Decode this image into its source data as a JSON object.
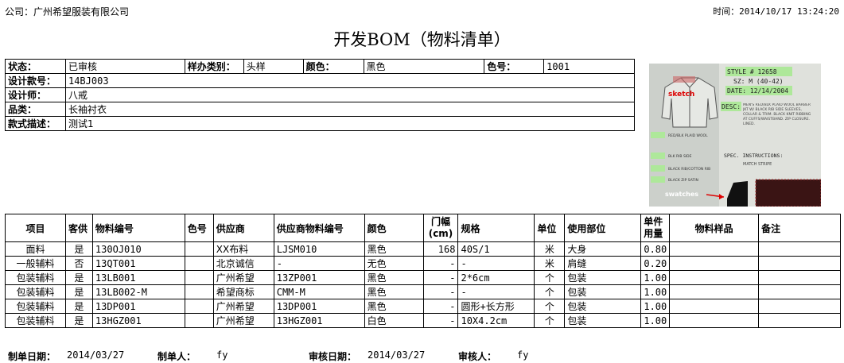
{
  "header": {
    "company": "公司：广州希望服装有限公司",
    "time": "时间：2014/10/17 13:24:20",
    "title": "开发BOM（物料清单）"
  },
  "info": {
    "status_label": "状态：",
    "status": "已审核",
    "sample_type_label": "样办类别：",
    "sample_type": "头样",
    "color_label": "颜色：",
    "color": "黑色",
    "color_no_label": "色号：",
    "color_no": "1001",
    "design_no_label": "设计款号：",
    "design_no": "14BJ003",
    "designer_label": "设计师：",
    "designer": "八戒",
    "category_label": "品类：",
    "category": "长袖衬衣",
    "style_desc_label": "款式描述：",
    "style_desc": "测试1"
  },
  "sketch": {
    "style": "STYLE # 12658",
    "size": "SZ: M (40-42)",
    "date": "DATE: 12/14/2004",
    "desc_label": "DESC:",
    "desc": "MEN'S RED/BLK PLAID WOOL BARBER JKT W/ BLACK RIB SIDE SLEEVES, COLLAR & TRIM. BLACK KNIT RIBBING AT CUFFS/WAISTBAND. ZIP CLOSURE. LINED.",
    "sketch_label": "sketch",
    "spec_label": "SPEC. INSTRUCTIONS:",
    "spec": "MATCH STRIPE",
    "swatches_label": "swatches",
    "swatch_notes": [
      "RED/BLK PLAID WOOL",
      "BLK RIB SIDE",
      "BLACK RIB/COTTON RIB",
      "BLACK ZIP SATIN"
    ]
  },
  "items": {
    "headers": [
      "项目",
      "客供",
      "物料编号",
      "色号",
      "供应商",
      "供应商物料编号",
      "颜色",
      "门幅(cm)",
      "规格",
      "单位",
      "使用部位",
      "单件用量",
      "物料样品",
      "备注"
    ],
    "rows": [
      [
        "面料",
        "是",
        "130OJ010",
        "",
        "XX布料",
        "LJSM010",
        "黑色",
        "168",
        "40S/1",
        "米",
        "大身",
        "0.80",
        "",
        ""
      ],
      [
        "一般辅料",
        "否",
        "13QT001",
        "",
        "北京诚信",
        "-",
        "无色",
        "-",
        "-",
        "米",
        "肩缝",
        "0.20",
        "",
        ""
      ],
      [
        "包装辅料",
        "是",
        "13LB001",
        "",
        "广州希望",
        "13ZP001",
        "黑色",
        "-",
        "2*6cm",
        "个",
        "包装",
        "1.00",
        "",
        ""
      ],
      [
        "包装辅料",
        "是",
        "13LB002-M",
        "",
        "希望商标",
        "CMM-M",
        "黑色",
        "-",
        "-",
        "个",
        "包装",
        "1.00",
        "",
        ""
      ],
      [
        "包装辅料",
        "是",
        "13DP001",
        "",
        "广州希望",
        "13DP001",
        "黑色",
        "-",
        "圆形+长方形",
        "个",
        "包装",
        "1.00",
        "",
        ""
      ],
      [
        "包装辅料",
        "是",
        "13HGZ001",
        "",
        "广州希望",
        "13HGZ001",
        "白色",
        "-",
        "10X4.2cm",
        "个",
        "包装",
        "1.00",
        "",
        ""
      ]
    ]
  },
  "footer": {
    "made_date_label": "制单日期：",
    "made_date": "2014/03/27",
    "maker_label": "制单人：",
    "maker": "fy",
    "review_date_label": "审核日期：",
    "review_date": "2014/03/27",
    "reviewer_label": "审核人：",
    "reviewer": "fy"
  }
}
